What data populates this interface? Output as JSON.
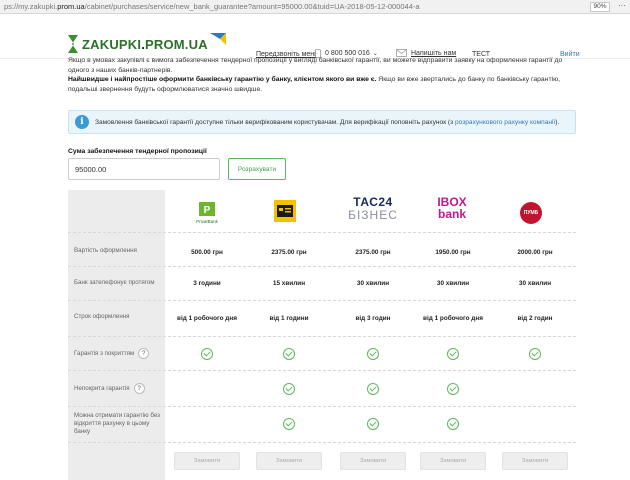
{
  "browser": {
    "url_prefix": "ps://my.zakupki.",
    "url_domain": "prom.ua",
    "url_path": "/cabinet/purchases/service/new_bank_guarantee?amount=95000.00&tuid=UA-2018-05-12-000044-a",
    "zoom": "90%",
    "more": "···"
  },
  "header": {
    "logo_main": "ZAKUPKI",
    "logo_dot": ".",
    "logo_domain": "PROM.UA",
    "call_label": "Передзвоніть мені",
    "phone": "0 800 500 016",
    "write_label": "Напишіть нам",
    "user": "ТЕСТ",
    "exit": "Вийти"
  },
  "intro": {
    "line1": "Якщо в умовах закупівлі є вимога забезпечення тендерної пропозиції у вигляді банківської гарантії, ви можете відправити заявку на оформлення гарантії до одного з наших банків-партнерів.",
    "bold": "Найшвидше і найпростіше оформити банківську гарантію у банку, клієнтом якого ви вже є.",
    "rest": " Якщо ви вже звертались до банку по банківську гарантію, подальші звернення будуть оформлюватися значно швидше."
  },
  "info": {
    "text": "Замовлення банківської гарантії доступне тільки верифікованим користувачам. Для верифікації поповніть рахунок (з ",
    "link": "розрахункового рахунку компанії",
    "tail": ")."
  },
  "sum": {
    "label": "Сума забезпечення тендерної пропозиції",
    "value": "95000.00",
    "button": "Розрахувати"
  },
  "banks": [
    {
      "name": "PrivatBank",
      "logo_text": "PrivatBank",
      "price": "500.00 грн",
      "callback": "3 години",
      "term": "від 1 робочого дня",
      "covered": true,
      "uncovered": false,
      "no_account": false,
      "order": "Замовити"
    },
    {
      "name": "Bank Kredyt Dnipro",
      "logo_text": "",
      "price": "2375.00 грн",
      "callback": "15 хвилин",
      "term": "від 1 години",
      "covered": true,
      "uncovered": true,
      "no_account": true,
      "order": "Замовити"
    },
    {
      "name": "TAC24 Бізнес",
      "logo_text": "ТАС24",
      "logo_sub": "БІЗНЕС",
      "price": "2375.00 грн",
      "callback": "30 хвилин",
      "term": "від 3 годин",
      "covered": true,
      "uncovered": true,
      "no_account": true,
      "order": "Замовити"
    },
    {
      "name": "IBOX bank",
      "logo_text": "IBOX",
      "logo_sub": "bank",
      "price": "1950.00 грн",
      "callback": "30 хвилин",
      "term": "від 1 робочого дня",
      "covered": true,
      "uncovered": true,
      "no_account": true,
      "order": "Замовити"
    },
    {
      "name": "ПУМБ",
      "logo_text": "ПУМБ",
      "price": "2000.00 грн",
      "callback": "30 хвилин",
      "term": "від 2 годин",
      "covered": true,
      "uncovered": false,
      "no_account": false,
      "order": "Замовити"
    }
  ],
  "rows": {
    "price": "Вартість оформлення",
    "callback": "Банк зателефонує протягом",
    "term": "Строк оформлення",
    "covered": "Гарантія з покриттям",
    "uncovered": "Непокрита гарантія",
    "no_account": "Можна отримати гарантію без відкриття рахунку в цьому банку",
    "help": "?"
  },
  "colors": {
    "brand_green": "#2c6f2a",
    "accent_blue": "#2f7ab8",
    "check_green": "#5cb85c",
    "label_bg": "#ececec"
  }
}
